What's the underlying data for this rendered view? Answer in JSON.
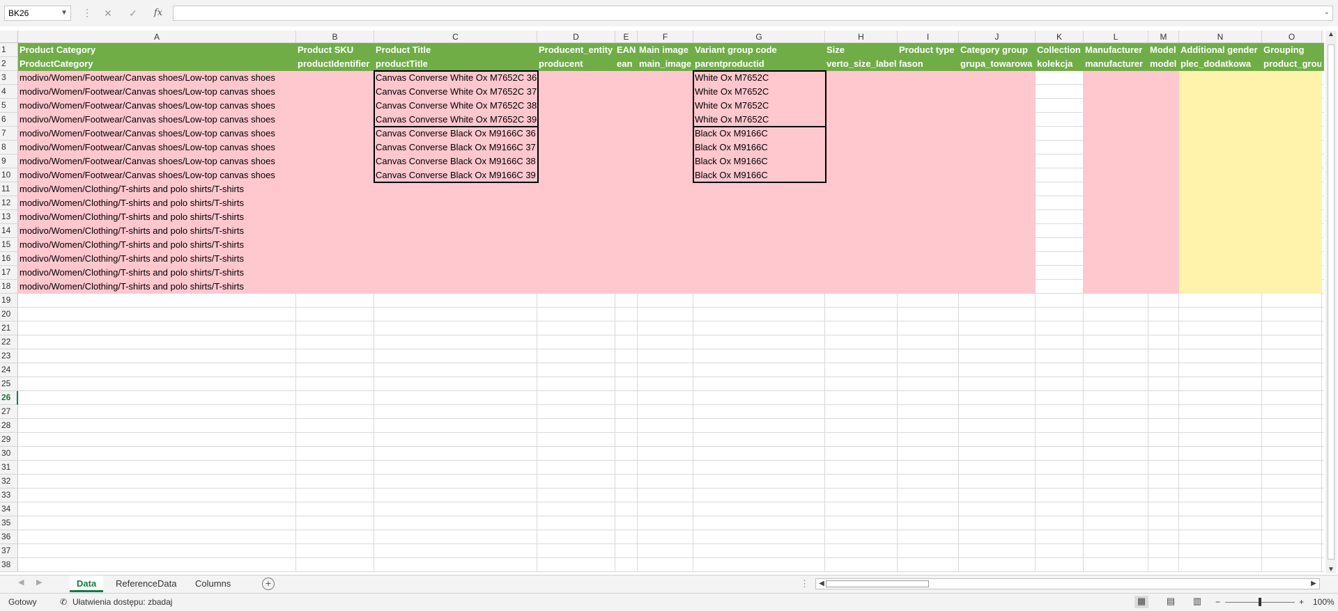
{
  "formula_bar": {
    "name_box": "BK26",
    "formula": "",
    "fx_label": "fx"
  },
  "columns": [
    {
      "letter": "A",
      "h1": "Product Category",
      "h2": "ProductCategory"
    },
    {
      "letter": "B",
      "h1": "Product SKU",
      "h2": "productIdentifier"
    },
    {
      "letter": "C",
      "h1": "Product Title",
      "h2": "productTitle"
    },
    {
      "letter": "D",
      "h1": "Producent_entity",
      "h2": "producent"
    },
    {
      "letter": "E",
      "h1": "EAN",
      "h2": "ean"
    },
    {
      "letter": "F",
      "h1": "Main image",
      "h2": "main_image"
    },
    {
      "letter": "G",
      "h1": "Variant group code",
      "h2": "parentproductid"
    },
    {
      "letter": "H",
      "h1": "Size",
      "h2": "verto_size_label"
    },
    {
      "letter": "I",
      "h1": "Product type",
      "h2": "fason"
    },
    {
      "letter": "J",
      "h1": "Category group",
      "h2": "grupa_towarowa"
    },
    {
      "letter": "K",
      "h1": "Collection",
      "h2": "kolekcja"
    },
    {
      "letter": "L",
      "h1": "Manufacturer",
      "h2": "manufacturer"
    },
    {
      "letter": "M",
      "h1": "Model",
      "h2": "model"
    },
    {
      "letter": "N",
      "h1": "Additional gender",
      "h2": "plec_dodatkowa"
    },
    {
      "letter": "O",
      "h1": "Grouping",
      "h2": "product_grou"
    },
    {
      "letter": "C",
      "h1": "",
      "h2": ""
    }
  ],
  "rows": [
    {
      "A": "modivo/Women/Footwear/Canvas shoes/Low-top canvas shoes",
      "C": "Canvas Converse White Ox M7652C 36",
      "G": "White Ox M7652C"
    },
    {
      "A": "modivo/Women/Footwear/Canvas shoes/Low-top canvas shoes",
      "C": "Canvas Converse White Ox M7652C 37",
      "G": "White Ox M7652C"
    },
    {
      "A": "modivo/Women/Footwear/Canvas shoes/Low-top canvas shoes",
      "C": "Canvas Converse White Ox M7652C 38",
      "G": "White Ox M7652C"
    },
    {
      "A": "modivo/Women/Footwear/Canvas shoes/Low-top canvas shoes",
      "C": "Canvas Converse White Ox M7652C 39",
      "G": "White Ox M7652C"
    },
    {
      "A": "modivo/Women/Footwear/Canvas shoes/Low-top canvas shoes",
      "C": "Canvas Converse Black Ox M9166C 36",
      "G": "Black Ox M9166C"
    },
    {
      "A": "modivo/Women/Footwear/Canvas shoes/Low-top canvas shoes",
      "C": "Canvas Converse Black Ox M9166C 37",
      "G": "Black Ox M9166C"
    },
    {
      "A": "modivo/Women/Footwear/Canvas shoes/Low-top canvas shoes",
      "C": "Canvas Converse Black Ox M9166C 38",
      "G": "Black Ox M9166C"
    },
    {
      "A": "modivo/Women/Footwear/Canvas shoes/Low-top canvas shoes",
      "C": "Canvas Converse Black Ox M9166C 39",
      "G": "Black Ox M9166C"
    },
    {
      "A": "modivo/Women/Clothing/T-shirts and polo shirts/T-shirts",
      "C": "",
      "G": ""
    },
    {
      "A": "modivo/Women/Clothing/T-shirts and polo shirts/T-shirts",
      "C": "",
      "G": ""
    },
    {
      "A": "modivo/Women/Clothing/T-shirts and polo shirts/T-shirts",
      "C": "",
      "G": ""
    },
    {
      "A": "modivo/Women/Clothing/T-shirts and polo shirts/T-shirts",
      "C": "",
      "G": ""
    },
    {
      "A": "modivo/Women/Clothing/T-shirts and polo shirts/T-shirts",
      "C": "",
      "G": ""
    },
    {
      "A": "modivo/Women/Clothing/T-shirts and polo shirts/T-shirts",
      "C": "",
      "G": ""
    },
    {
      "A": "modivo/Women/Clothing/T-shirts and polo shirts/T-shirts",
      "C": "",
      "G": ""
    },
    {
      "A": "modivo/Women/Clothing/T-shirts and polo shirts/T-shirts",
      "C": "",
      "G": ""
    }
  ],
  "row_numbers": [
    "1",
    "2",
    "3",
    "4",
    "5",
    "6",
    "7",
    "8",
    "9",
    "10",
    "11",
    "12",
    "13",
    "14",
    "15",
    "16",
    "17",
    "18",
    "19",
    "20",
    "21",
    "22",
    "23",
    "24",
    "25",
    "26",
    "27",
    "28",
    "29",
    "30",
    "31",
    "32",
    "33",
    "34",
    "35",
    "36",
    "37",
    "38"
  ],
  "active_row": "26",
  "sheet_tabs": [
    "Data",
    "ReferenceData",
    "Columns"
  ],
  "active_tab": "Data",
  "status": {
    "ready": "Gotowy",
    "accessibility": "Ułatwienia dostępu: zbadaj",
    "zoom": "100%"
  },
  "colors": {
    "header_green": "#70ad47",
    "pink_fill": "#ffc7ce",
    "yellow_fill": "#fff2ab",
    "excel_green": "#107c41"
  }
}
